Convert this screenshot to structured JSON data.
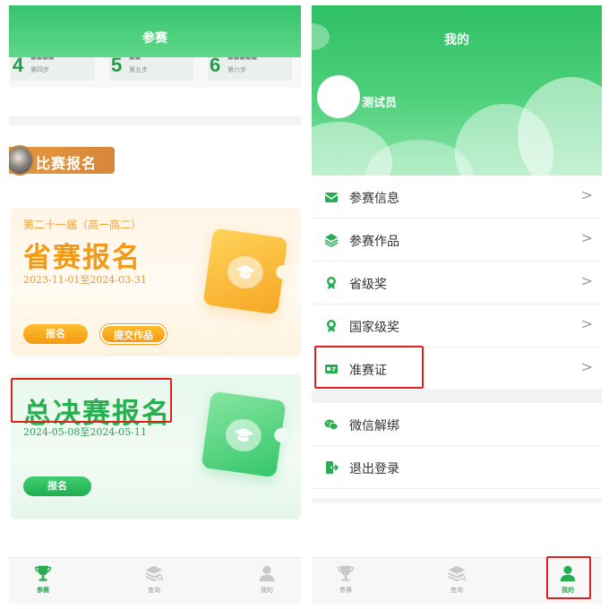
{
  "left": {
    "header_title": "参赛",
    "steps": [
      {
        "num": "4",
        "label": "第四步"
      },
      {
        "num": "5",
        "label": "第五步"
      },
      {
        "num": "6",
        "label": "第六步"
      }
    ],
    "section_title": "比赛报名",
    "provincial": {
      "subtitle": "第二十一届（高一高二）",
      "title": "省赛报名",
      "dates": "2023-11-01至2024-03-31",
      "register_label": "报名",
      "submit_label": "提交作品"
    },
    "final": {
      "title": "总决赛报名",
      "dates": "2024-05-08至2024-05-11",
      "register_label": "报名"
    }
  },
  "right": {
    "header_title": "我的",
    "username": "测试员",
    "menu": [
      {
        "label": "参赛信息",
        "icon": "envelope-icon"
      },
      {
        "label": "参赛作品",
        "icon": "layers-icon"
      },
      {
        "label": "省级奖",
        "icon": "award-icon"
      },
      {
        "label": "国家级奖",
        "icon": "award-icon"
      },
      {
        "label": "准赛证",
        "icon": "id-card-icon"
      }
    ],
    "menu2": [
      {
        "label": "微信解绑",
        "icon": "wechat-icon"
      },
      {
        "label": "退出登录",
        "icon": "logout-icon"
      }
    ]
  },
  "tabbar": {
    "tabs": [
      {
        "label": "参赛",
        "icon": "trophy-icon"
      },
      {
        "label": "查询",
        "icon": "stack-search-icon"
      },
      {
        "label": "我的",
        "icon": "user-icon"
      }
    ],
    "left_active": "参赛",
    "right_active": "我的"
  },
  "colors": {
    "brand_green": "#2fc064",
    "accent_orange": "#f39a12",
    "highlight_red": "#e0201c"
  },
  "arrow_glyph": ">"
}
